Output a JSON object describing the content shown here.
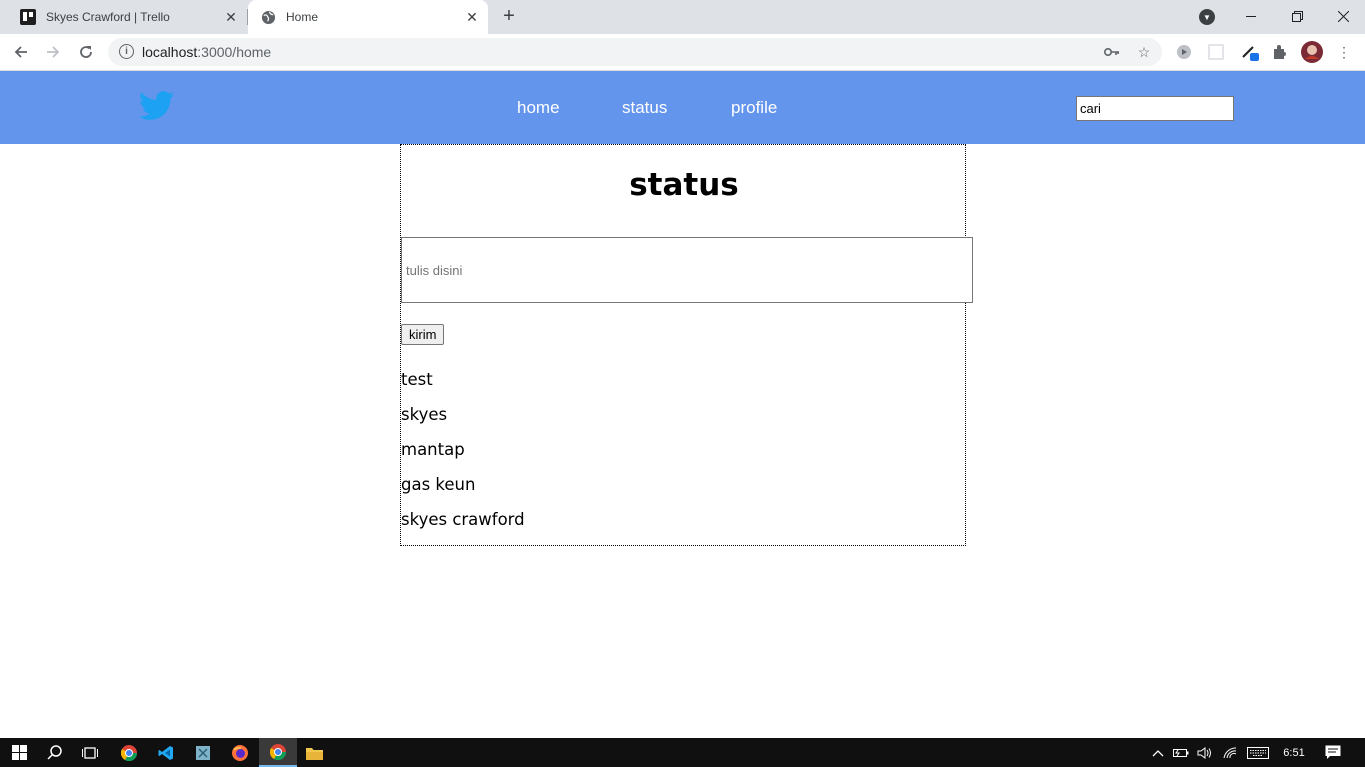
{
  "browser": {
    "tabs": [
      {
        "title": "Skyes Crawford | Trello",
        "icon": "trello-icon"
      },
      {
        "title": "Home",
        "icon": "globe-icon"
      }
    ],
    "url_host": "localhost",
    "url_rest": ":3000/home"
  },
  "navbar": {
    "logo": "twitter-bird-icon",
    "links": [
      "home",
      "status",
      "profile"
    ],
    "search_value": "cari"
  },
  "main": {
    "title": "status",
    "input_placeholder": "tulis disini",
    "send_label": "kirim",
    "statuses": [
      "test",
      "skyes",
      "mantap",
      "gas keun",
      "skyes crawford"
    ]
  },
  "taskbar": {
    "time": "6:51"
  },
  "colors": {
    "navbar_bg": "#6495ed",
    "logo": "#1da1f2"
  }
}
